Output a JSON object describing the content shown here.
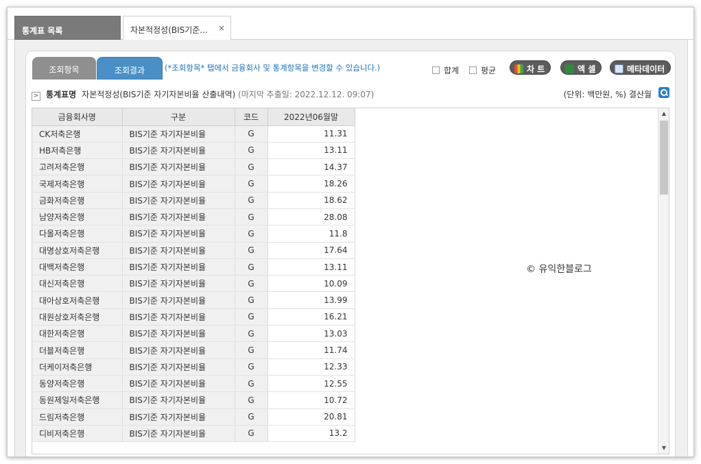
{
  "tabs": {
    "list_label": "통계표 목록",
    "active_label": "자본적정성(BIS기준...",
    "close_glyph": "×"
  },
  "subtabs": {
    "query_label": "조회항목",
    "result_label": "조회결과",
    "hint": "(*조회항목* 탭에서 금융회사 및 통계항목을 변경할 수 있습니다.)"
  },
  "options": {
    "sum_label": "합계",
    "avg_label": "평균"
  },
  "buttons": {
    "chart_label": "차 트",
    "excel_label": "엑 셀",
    "meta_label": "메타데이터",
    "chart_icon": "bar-chart-icon",
    "excel_icon": "excel-icon",
    "meta_icon": "document-icon"
  },
  "info": {
    "label": "통계표명",
    "title": "자본적정성(BIS기준 자기자본비율 산출내역)",
    "extract": "(마지막 추출일: 2022.12.12. 09:07)",
    "unit": "(단위: 백만원, %)  결산월"
  },
  "table": {
    "headers": [
      "금융회사명",
      "구분",
      "코드",
      "2022년06월말"
    ],
    "rows": [
      [
        "CK저축은행",
        "BIS기준 자기자본비율",
        "G",
        "11.31"
      ],
      [
        "HB저축은행",
        "BIS기준 자기자본비율",
        "G",
        "13.11"
      ],
      [
        "고려저축은행",
        "BIS기준 자기자본비율",
        "G",
        "14.37"
      ],
      [
        "국제저축은행",
        "BIS기준 자기자본비율",
        "G",
        "18.26"
      ],
      [
        "금화저축은행",
        "BIS기준 자기자본비율",
        "G",
        "18.62"
      ],
      [
        "남양저축은행",
        "BIS기준 자기자본비율",
        "G",
        "28.08"
      ],
      [
        "다올저축은행",
        "BIS기준 자기자본비율",
        "G",
        "11.8"
      ],
      [
        "대명상호저축은행",
        "BIS기준 자기자본비율",
        "G",
        "17.64"
      ],
      [
        "대백저축은행",
        "BIS기준 자기자본비율",
        "G",
        "13.11"
      ],
      [
        "대신저축은행",
        "BIS기준 자기자본비율",
        "G",
        "10.09"
      ],
      [
        "대아상호저축은행",
        "BIS기준 자기자본비율",
        "G",
        "13.99"
      ],
      [
        "대원상호저축은행",
        "BIS기준 자기자본비율",
        "G",
        "16.21"
      ],
      [
        "대한저축은행",
        "BIS기준 자기자본비율",
        "G",
        "13.03"
      ],
      [
        "더블저축은행",
        "BIS기준 자기자본비율",
        "G",
        "11.74"
      ],
      [
        "더케이저축은행",
        "BIS기준 자기자본비율",
        "G",
        "12.33"
      ],
      [
        "동양저축은행",
        "BIS기준 자기자본비율",
        "G",
        "12.55"
      ],
      [
        "동원제일저축은행",
        "BIS기준 자기자본비율",
        "G",
        "10.72"
      ],
      [
        "드림저축은행",
        "BIS기준 자기자본비율",
        "G",
        "20.81"
      ],
      [
        "디비저축은행",
        "BIS기준 자기자본비율",
        "G",
        "13.2"
      ]
    ]
  },
  "watermark": "© 유익한블로그"
}
